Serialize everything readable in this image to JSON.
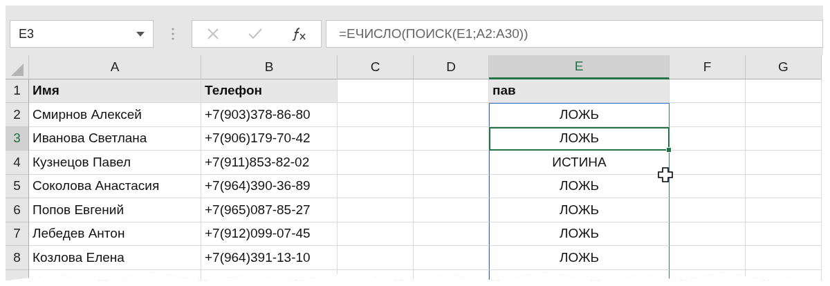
{
  "name_box": {
    "value": "E3"
  },
  "formula_bar": {
    "value": "=ЕЧИСЛО(ПОИСК(E1;A2:A30))"
  },
  "formula_buttons": [
    {
      "kind": "cancel",
      "disabled": true
    },
    {
      "kind": "enter",
      "disabled": true
    },
    {
      "kind": "function",
      "disabled": false
    }
  ],
  "columns": [
    {
      "label": "A",
      "selected": false
    },
    {
      "label": "B",
      "selected": false
    },
    {
      "label": "C",
      "selected": false
    },
    {
      "label": "D",
      "selected": false
    },
    {
      "label": "E",
      "selected": true
    },
    {
      "label": "F",
      "selected": false
    },
    {
      "label": "G",
      "selected": false
    }
  ],
  "rows": [
    {
      "number": "1",
      "selected": false,
      "kind": "header",
      "cells": {
        "column_a": "Имя",
        "column_b": "Телефон",
        "column_e": "пав"
      }
    },
    {
      "number": "2",
      "selected": false,
      "kind": "data",
      "cells": {
        "column_a": "Смирнов Алексей",
        "column_b": "+7(903)378-86-80",
        "column_e": "ЛОЖЬ"
      }
    },
    {
      "number": "3",
      "selected": true,
      "kind": "data",
      "cells": {
        "column_a": "Иванова Светлана",
        "column_b": "+7(906)179-70-42",
        "column_e": "ЛОЖЬ"
      }
    },
    {
      "number": "4",
      "selected": false,
      "kind": "data",
      "cells": {
        "column_a": "Кузнецов Павел",
        "column_b": "+7(911)853-82-02",
        "column_e": "ИСТИНА"
      }
    },
    {
      "number": "5",
      "selected": false,
      "kind": "data",
      "cells": {
        "column_a": "Соколова Анастасия",
        "column_b": "+7(964)390-36-89",
        "column_e": "ЛОЖЬ"
      }
    },
    {
      "number": "6",
      "selected": false,
      "kind": "data",
      "cells": {
        "column_a": "Попов Евгений",
        "column_b": "+7(965)087-85-27",
        "column_e": "ЛОЖЬ"
      }
    },
    {
      "number": "7",
      "selected": false,
      "kind": "data",
      "cells": {
        "column_a": "Лебедев Антон",
        "column_b": "+7(912)099-07-45",
        "column_e": "ЛОЖЬ"
      }
    },
    {
      "number": "8",
      "selected": false,
      "kind": "data",
      "cells": {
        "column_a": "Козлова Елена",
        "column_b": "+7(964)391-13-10",
        "column_e": "ЛОЖЬ"
      }
    }
  ]
}
